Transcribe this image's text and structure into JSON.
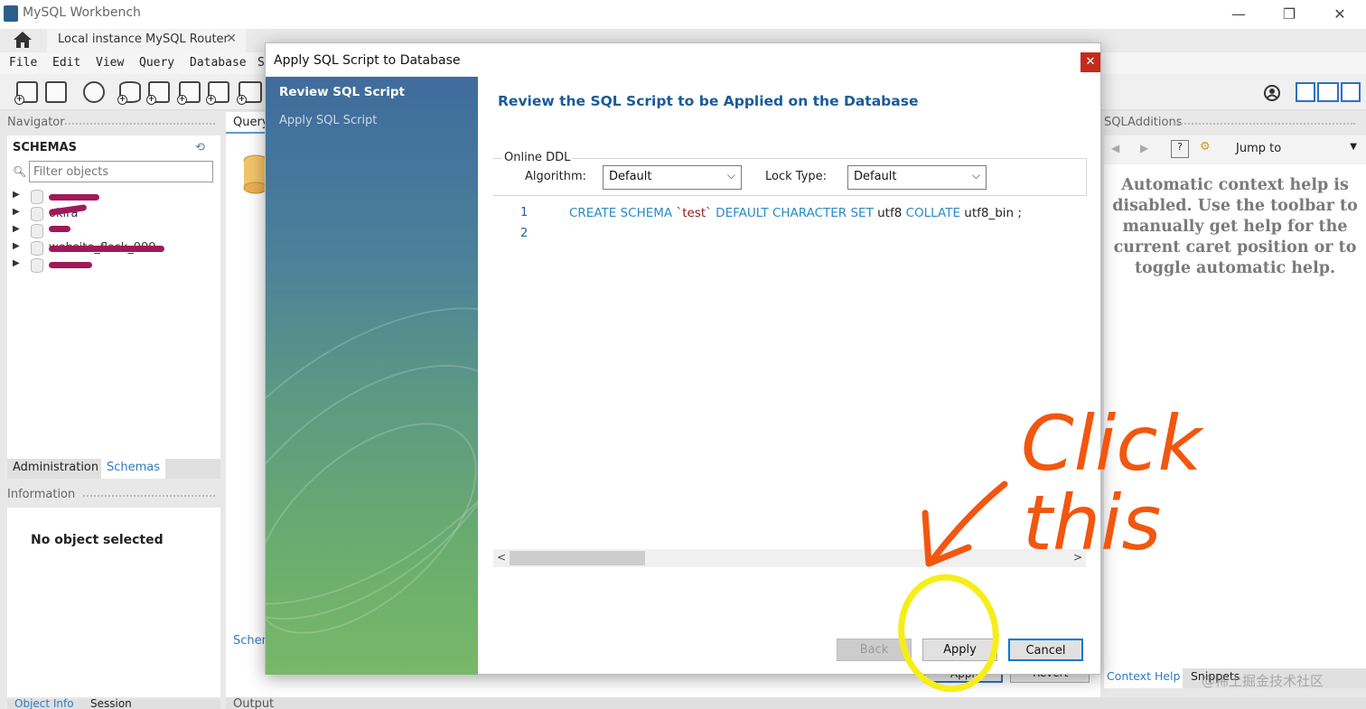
{
  "window": {
    "title": "MySQL Workbench",
    "tab_label": "Local instance MySQL Router",
    "tab_close": "✕",
    "minimize": "—",
    "restore": "❐",
    "close": "✕"
  },
  "menu": [
    "File",
    "Edit",
    "View",
    "Query",
    "Database",
    "S"
  ],
  "navigator": {
    "header": "Navigator",
    "schemas_title": "SCHEMAS",
    "filter_placeholder": "Filter objects",
    "schemas": [
      {
        "name": "",
        "scribbled": true
      },
      {
        "name": "okira",
        "scribbled": true
      },
      {
        "name": "",
        "scribbled": true
      },
      {
        "name": "website_flask_999",
        "scribbled": true
      },
      {
        "name": "",
        "scribbled": true
      }
    ],
    "bottom_tabs": [
      "Administration",
      "Schemas"
    ],
    "info_header": "Information",
    "no_object": "No object selected",
    "object_tabs": [
      "Object Info",
      "Session"
    ]
  },
  "query": {
    "tab": "Query",
    "schem_label": "Schem",
    "output_label": "Output",
    "bg_apply": "Apply",
    "bg_revert": "Revert"
  },
  "sql_additions": {
    "header": "SQLAdditions",
    "jump_to": "Jump to",
    "help_text": "Automatic context help is disabled. Use the toolbar to manually get help for the current caret position or to toggle automatic help.",
    "tabs": [
      "Context Help",
      "Snippets"
    ]
  },
  "dialog": {
    "title": "Apply SQL Script to Database",
    "close": "✕",
    "steps": [
      "Review SQL Script",
      "Apply SQL Script"
    ],
    "heading": "Review the SQL Script to be Applied on the Database",
    "online_ddl": "Online DDL",
    "algorithm_label": "Algorithm:",
    "algorithm_value": "Default",
    "lock_label": "Lock Type:",
    "lock_value": "Default",
    "code_lines": [
      {
        "no": "1",
        "kw1": "CREATE SCHEMA ",
        "str": "`test`",
        "kw2": " DEFAULT CHARACTER SET ",
        "id1": "utf8",
        "kw3": " COLLATE ",
        "id2": "utf8_bin ;"
      },
      {
        "no": "2"
      }
    ],
    "buttons": {
      "back": "Back",
      "apply": "Apply",
      "cancel": "Cancel"
    }
  },
  "annotation": {
    "text_line1": "Click",
    "text_line2": "this",
    "arrow_color": "#f2560f",
    "circle_color": "#f5ee1a"
  },
  "watermark": "@稀土掘金技术社区",
  "colors": {
    "accent": "#0078d7",
    "heading": "#1a5a9a",
    "sql_keyword": "#2a8ac4",
    "sql_string": "#8b1a1a"
  }
}
